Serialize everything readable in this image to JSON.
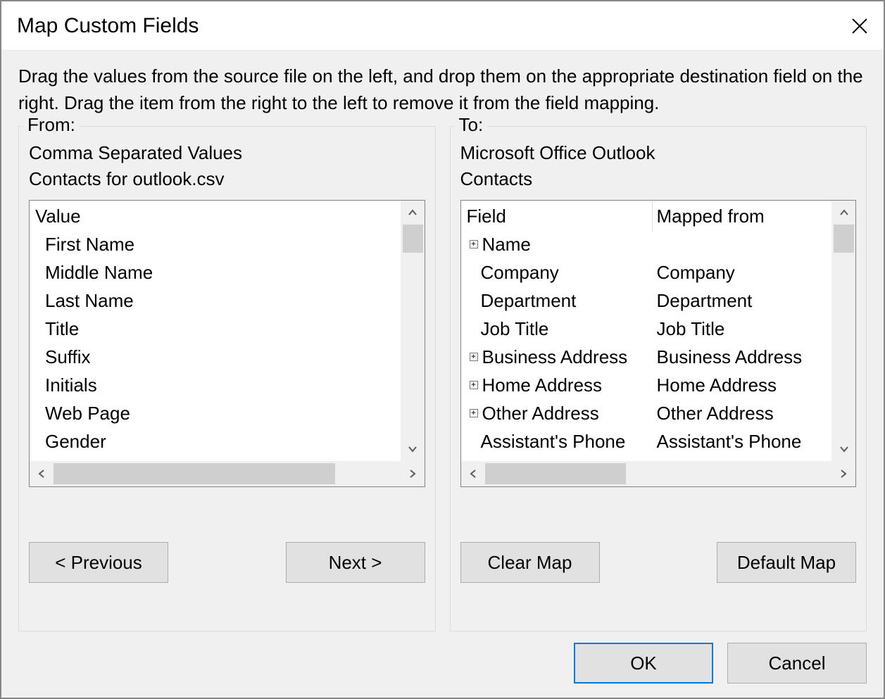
{
  "title": "Map Custom Fields",
  "instructions": "Drag the values from the source file on the left, and drop them on the appropriate destination field on the right.  Drag the item from the right to the left to remove it from the field mapping.",
  "from": {
    "legend": "From:",
    "line1": "Comma Separated Values",
    "line2": "Contacts for outlook.csv",
    "header": "Value",
    "items": [
      "First Name",
      "Middle Name",
      "Last Name",
      "Title",
      "Suffix",
      "Initials",
      "Web Page",
      "Gender"
    ],
    "prev_label": "< Previous",
    "next_label": "Next >"
  },
  "to": {
    "legend": "To:",
    "line1": "Microsoft Office Outlook",
    "line2": "Contacts",
    "header_field": "Field",
    "header_mapped": "Mapped from",
    "rows": [
      {
        "field": "Name",
        "mapped": "",
        "expandable": true,
        "child": false
      },
      {
        "field": "Company",
        "mapped": "Company",
        "expandable": false,
        "child": true
      },
      {
        "field": "Department",
        "mapped": "Department",
        "expandable": false,
        "child": true
      },
      {
        "field": "Job Title",
        "mapped": "Job Title",
        "expandable": false,
        "child": true
      },
      {
        "field": "Business Address",
        "mapped": "Business Address",
        "expandable": true,
        "child": false
      },
      {
        "field": "Home Address",
        "mapped": "Home Address",
        "expandable": true,
        "child": false
      },
      {
        "field": "Other Address",
        "mapped": "Other Address",
        "expandable": true,
        "child": false
      },
      {
        "field": "Assistant's Phone",
        "mapped": "Assistant's Phone",
        "expandable": false,
        "child": true
      }
    ],
    "clear_label": "Clear Map",
    "default_label": "Default Map"
  },
  "footer": {
    "ok_label": "OK",
    "cancel_label": "Cancel"
  }
}
